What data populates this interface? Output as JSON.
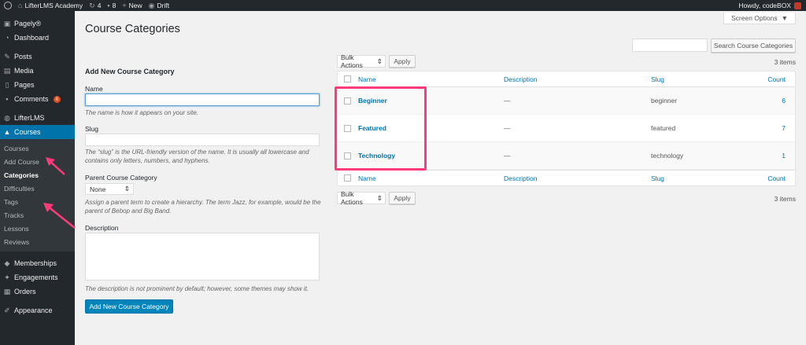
{
  "adminbar": {
    "site_name": "LifterLMS Academy",
    "updates_count": "4",
    "comments_count": "8",
    "new_label": "New",
    "drift_label": "Drift",
    "greeting": "Howdy, codeBOX"
  },
  "sidebar": {
    "items_top": [
      {
        "label": "Pagely®",
        "icon": "pagely-icon"
      },
      {
        "label": "Dashboard",
        "icon": "dashboard-icon"
      }
    ],
    "items_mid": [
      {
        "label": "Posts",
        "icon": "pin-icon"
      },
      {
        "label": "Media",
        "icon": "media-icon"
      },
      {
        "label": "Pages",
        "icon": "page-icon"
      },
      {
        "label": "Comments",
        "icon": "comment-icon",
        "badge": "8"
      }
    ],
    "lifter": {
      "label": "LifterLMS",
      "icon": "lifterlms-icon"
    },
    "courses": {
      "label": "Courses",
      "icon": "graduation-cap-icon"
    },
    "submenu": [
      "Courses",
      "Add Course",
      "Categories",
      "Difficulties",
      "Tags",
      "Tracks",
      "Lessons",
      "Reviews"
    ],
    "items_bottom": [
      {
        "label": "Memberships",
        "icon": "membership-icon"
      },
      {
        "label": "Engagements",
        "icon": "engagement-icon"
      },
      {
        "label": "Orders",
        "icon": "cart-icon"
      }
    ],
    "appearance": {
      "label": "Appearance",
      "icon": "brush-icon"
    }
  },
  "screen_options": "Screen Options",
  "page_title": "Course Categories",
  "search": {
    "button": "Search Course Categories",
    "value": ""
  },
  "form": {
    "heading": "Add New Course Category",
    "name_label": "Name",
    "name_desc": "The name is how it appears on your site.",
    "slug_label": "Slug",
    "slug_desc": "The “slug” is the URL-friendly version of the name. It is usually all lowercase and contains only letters, numbers, and hyphens.",
    "parent_label": "Parent Course Category",
    "parent_value": "None",
    "parent_desc": "Assign a parent term to create a hierarchy. The term Jazz, for example, would be the parent of Bebop and Big Band.",
    "description_label": "Description",
    "description_desc": "The description is not prominent by default; however, some themes may show it.",
    "submit": "Add New Course Category"
  },
  "tablenav": {
    "bulk_actions": "Bulk Actions",
    "apply": "Apply",
    "items": "3 items"
  },
  "table": {
    "columns": {
      "name": "Name",
      "description": "Description",
      "slug": "Slug",
      "count": "Count"
    },
    "rows": [
      {
        "name": "Beginner",
        "description": "—",
        "slug": "beginner",
        "count": "6"
      },
      {
        "name": "Featured",
        "description": "—",
        "slug": "featured",
        "count": "7"
      },
      {
        "name": "Technology",
        "description": "—",
        "slug": "technology",
        "count": "1"
      }
    ]
  },
  "colors": {
    "accent": "#0073aa",
    "highlight": "#ff3b79",
    "sidebar": "#23282d"
  }
}
